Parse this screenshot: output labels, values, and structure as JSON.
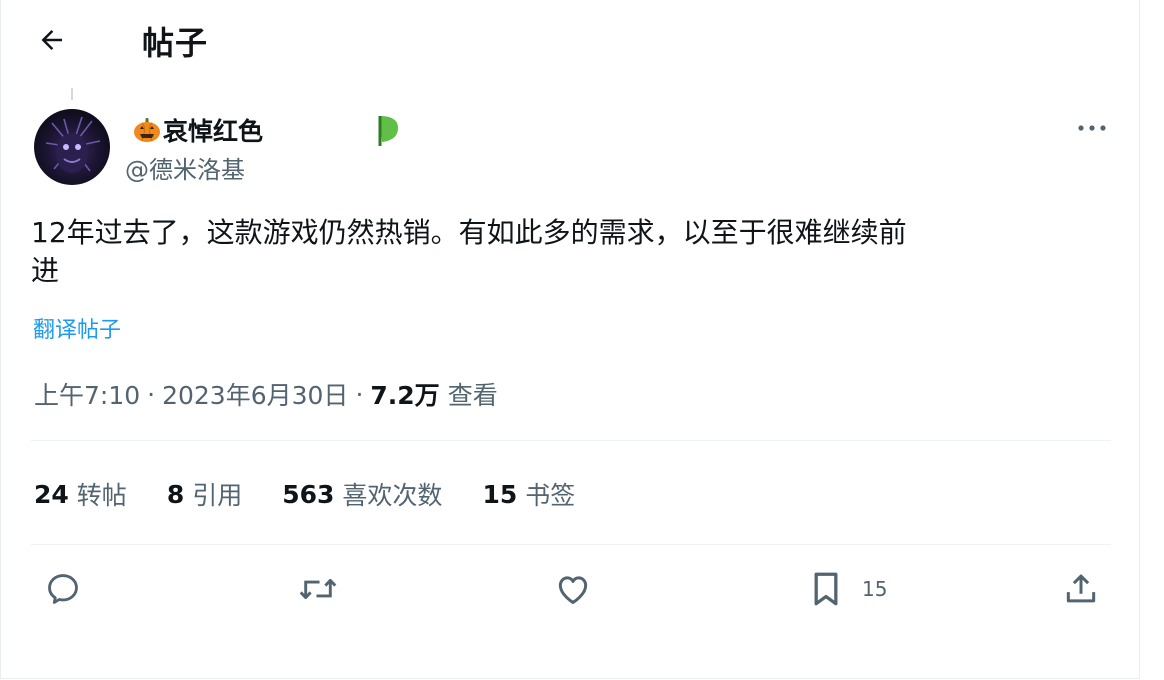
{
  "header": {
    "title": "帖子",
    "back_icon": "arrow-left-icon"
  },
  "author": {
    "display_name": "哀悼红色",
    "handle": "@德米洛基",
    "emoji_icon": "pumpkin-icon",
    "badge_icon": "green-badge-icon"
  },
  "tweet": {
    "text_line1": "12年过去了，这款游戏仍然热销。有如此多的需求，以至于很难继续前",
    "text_line2": "进",
    "translate_label": "翻译帖子",
    "time": "上午7:10",
    "date": "2023年6月30日",
    "views_count": "7.2万",
    "views_label": "查看",
    "separator": "·"
  },
  "stats": [
    {
      "count": "24",
      "label": "转帖"
    },
    {
      "count": "8",
      "label": "引用"
    },
    {
      "count": "563",
      "label": "喜欢次数"
    },
    {
      "count": "15",
      "label": "书签"
    }
  ],
  "actions": {
    "bookmark_count": "15",
    "icons": [
      "reply-icon",
      "retweet-icon",
      "like-icon",
      "bookmark-icon",
      "share-icon"
    ]
  },
  "colors": {
    "accent": "#1d9bf0",
    "text": "#0f1419",
    "muted": "#536471",
    "border": "#eff3f4"
  }
}
